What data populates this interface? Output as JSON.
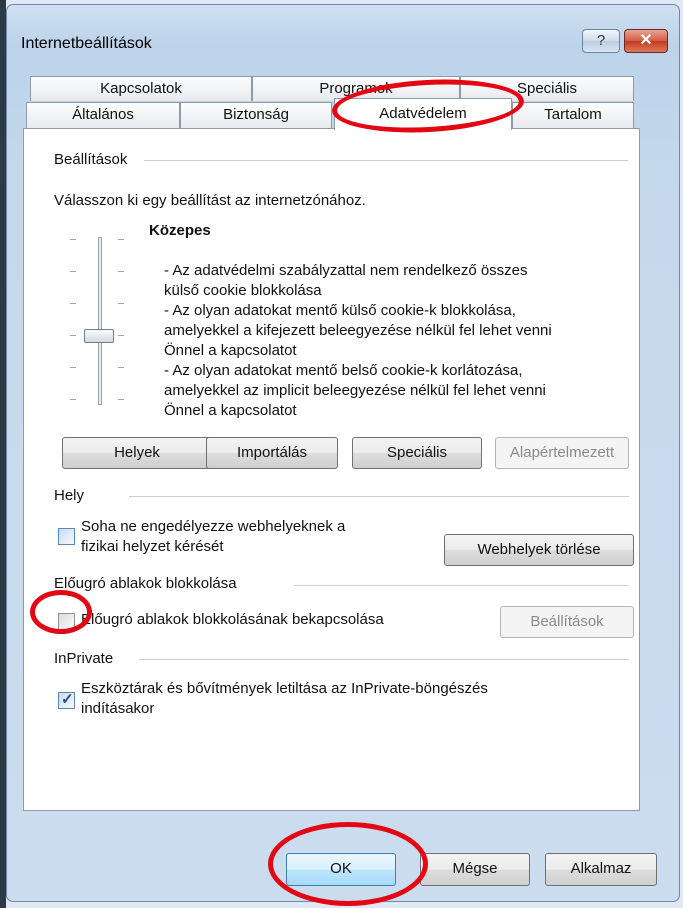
{
  "window": {
    "title": "Internetbeállítások",
    "help_glyph": "?",
    "close_glyph": "✕"
  },
  "tabs": {
    "row1": [
      "Kapcsolatok",
      "Programok",
      "Speciális"
    ],
    "row2": [
      "Általános",
      "Biztonság",
      "Adatvédelem",
      "Tartalom"
    ],
    "active": "Adatvédelem"
  },
  "settings": {
    "group_label": "Beállítások",
    "instruction": "Válasszon ki egy beállítást az internetzónához.",
    "level_title": "Közepes",
    "level_description": [
      "- Az adatvédelmi szabályzattal nem rendelkező összes",
      "külső cookie blokkolása",
      "- Az olyan adatokat mentő külső cookie-k blokkolása,",
      "amelyekkel a kifejezett beleegyezése nélkül fel lehet venni",
      "Önnel a kapcsolatot",
      "- Az olyan adatokat mentő belső cookie-k korlátozása,",
      "amelyekkel az implicit beleegyezése nélkül fel lehet venni",
      "Önnel a kapcsolatot"
    ],
    "buttons": {
      "sites": "Helyek",
      "import": "Importálás",
      "advanced": "Speciális",
      "default": "Alapértelmezett"
    }
  },
  "location": {
    "group_label": "Hely",
    "checkbox_label_line1": "Soha ne engedélyezze webhelyeknek a",
    "checkbox_label_line2": "fizikai helyzet kérését",
    "checked": false,
    "clear_sites_button": "Webhelyek törlése"
  },
  "popup": {
    "group_label": "Előugró ablakok blokkolása",
    "checkbox_label": "Előugró ablakok blokkolásának bekapcsolása",
    "checked": false,
    "settings_button": "Beállítások"
  },
  "inprivate": {
    "group_label": "InPrivate",
    "checkbox_label_line1": "Eszköztárak és bővítmények letiltása az InPrivate-böngészés",
    "checkbox_label_line2": "indításakor",
    "checked": true
  },
  "footer": {
    "ok": "OK",
    "cancel": "Mégse",
    "apply": "Alkalmaz"
  },
  "annotation_color": "#e30613"
}
